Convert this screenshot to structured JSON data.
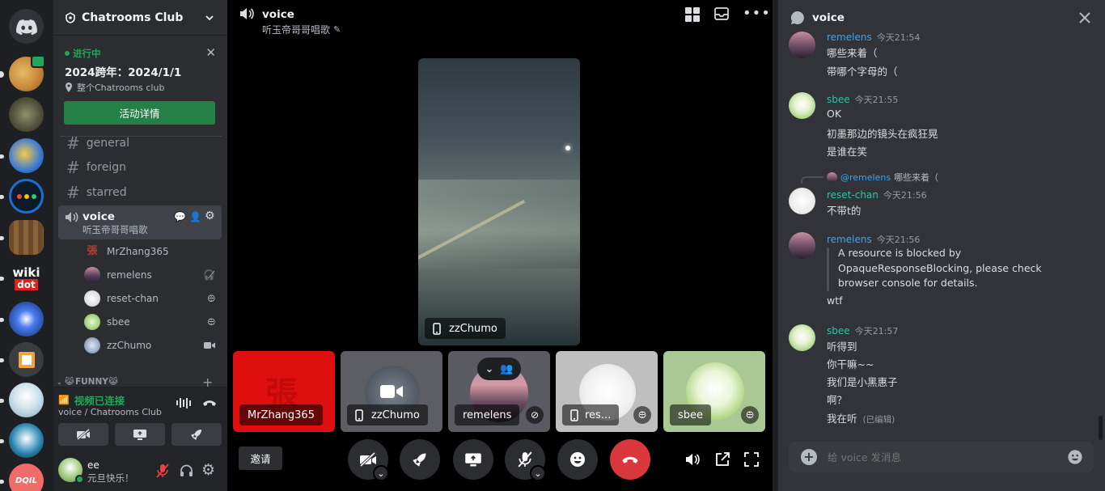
{
  "server": {
    "name": "Chatrooms Club",
    "event": {
      "status": "进行中",
      "title": "2024跨年：2024/1/1",
      "location": "整个Chatrooms club",
      "button": "活动详情"
    },
    "channels": [
      "general",
      "foreign",
      "starred"
    ],
    "voice_channel": {
      "name": "voice",
      "status": "听玉帝哥哥唱歌",
      "members": [
        "MrZhang365",
        "remelens",
        "reset-chan",
        "sbee",
        "zzChumo"
      ]
    },
    "category": "FUNNY"
  },
  "connection": {
    "status": "视频已连接",
    "location": "voice / Chatrooms Club"
  },
  "user": {
    "name": "ee",
    "status": "元旦快乐！"
  },
  "main": {
    "channel": "voice",
    "status": "听玉帝哥哥唱歌",
    "featured": "zzChumo",
    "tiles": [
      "MrZhang365",
      "zzChumo",
      "remelens",
      "res...",
      "sbee"
    ],
    "invite": "邀请"
  },
  "chat": {
    "title": "voice",
    "messages": [
      {
        "user": "remelens",
        "time": "今天21:54",
        "color": "#3ba5f6",
        "lines": [
          "哪些来着（",
          "带哪个字母的（"
        ]
      },
      {
        "user": "sbee",
        "time": "今天21:55",
        "color": "#2dc5a6",
        "lines": [
          "OK",
          "初墨那边的镜头在疯狂晃",
          "是谁在笑"
        ]
      },
      {
        "user": "reset-chan",
        "time": "今天21:56",
        "color": "#2dc5a6",
        "reply_user": "@remelens",
        "reply_text": "哪些来着（",
        "lines": [
          "不带t的"
        ]
      },
      {
        "user": "remelens",
        "time": "今天21:56",
        "color": "#3ba5f6",
        "quote": [
          "A resource is blocked by",
          "OpaqueResponseBlocking, please check",
          "browser console for details."
        ],
        "lines": [
          "wtf"
        ]
      },
      {
        "user": "sbee",
        "time": "今天21:57",
        "color": "#2dc5a6",
        "lines": [
          "听得到",
          "你干嘛~~",
          "我们是小黑惠子",
          "啊？",
          "我在听"
        ],
        "edited": "(已编辑)"
      }
    ],
    "placeholder": "给 voice 发消息"
  }
}
